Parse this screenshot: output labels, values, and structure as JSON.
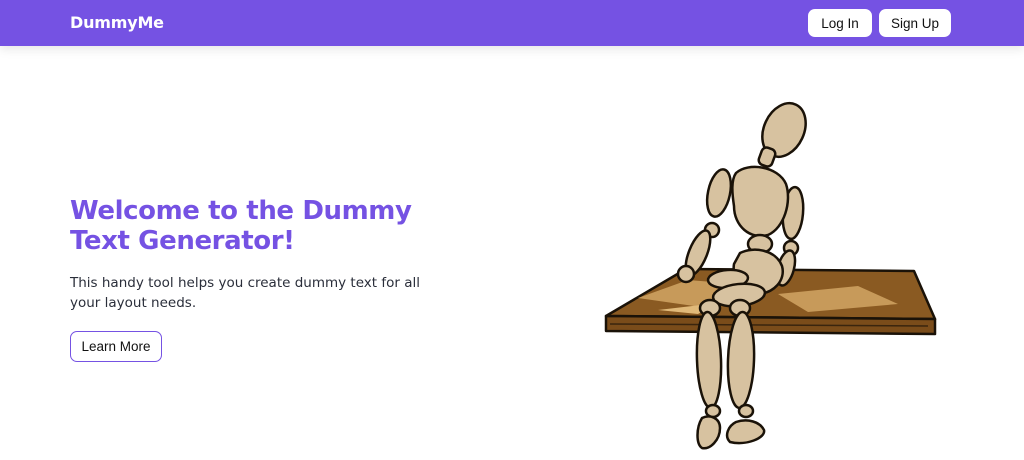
{
  "navbar": {
    "brand": "DummyMe",
    "login_label": "Log In",
    "signup_label": "Sign Up"
  },
  "hero": {
    "title": "Welcome to the Dummy Text Generator!",
    "description": "This handy tool helps you create dummy text for all your layout needs.",
    "cta_label": "Learn More"
  },
  "colors": {
    "accent": "#7552e3",
    "wood": "#8a5a22",
    "mannequin": "#d7c2a0"
  },
  "illustration": {
    "subject": "wooden-mannequin-on-bench"
  }
}
